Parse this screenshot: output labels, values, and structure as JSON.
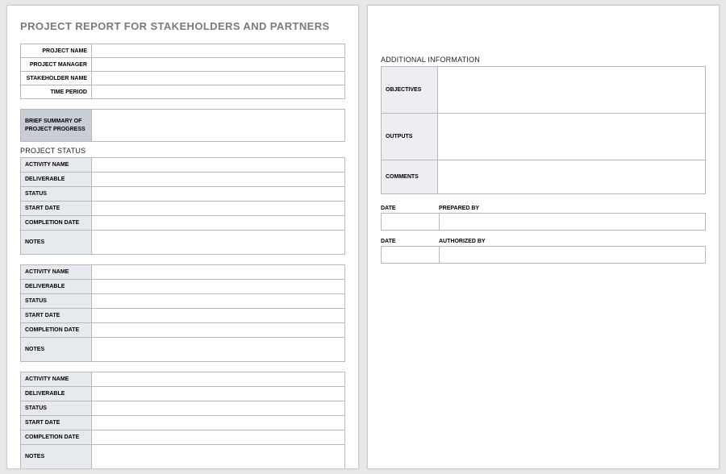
{
  "title": "PROJECT REPORT FOR STAKEHOLDERS AND PARTNERS",
  "projectInfo": {
    "labels": {
      "projectName": "PROJECT NAME",
      "projectManager": "PROJECT MANAGER",
      "stakeholderName": "STAKEHOLDER NAME",
      "timePeriod": "TIME PERIOD"
    },
    "values": {
      "projectName": "",
      "projectManager": "",
      "stakeholderName": "",
      "timePeriod": ""
    }
  },
  "summary": {
    "label": "BRIEF SUMMARY OF PROJECT PROGRESS",
    "value": ""
  },
  "projectStatusHeading": "PROJECT STATUS",
  "statusLabels": {
    "activityName": "ACTIVITY NAME",
    "deliverable": "DELIVERABLE",
    "status": "STATUS",
    "startDate": "START DATE",
    "completionDate": "COMPLETION DATE",
    "notes": "NOTES"
  },
  "statusBlocks": [
    {
      "activityName": "",
      "deliverable": "",
      "status": "",
      "startDate": "",
      "completionDate": "",
      "notes": ""
    },
    {
      "activityName": "",
      "deliverable": "",
      "status": "",
      "startDate": "",
      "completionDate": "",
      "notes": ""
    },
    {
      "activityName": "",
      "deliverable": "",
      "status": "",
      "startDate": "",
      "completionDate": "",
      "notes": ""
    }
  ],
  "page2": {
    "additionalInfoHeading": "ADDITIONAL INFORMATION",
    "fields": {
      "objectives": {
        "label": "OBJECTIVES",
        "value": ""
      },
      "outputs": {
        "label": "OUTPUTS",
        "value": ""
      },
      "comments": {
        "label": "COMMENTS",
        "value": ""
      }
    },
    "sign": {
      "dateLabel": "DATE",
      "preparedByLabel": "PREPARED BY",
      "authorizedByLabel": "AUTHORIZED BY",
      "prepared": {
        "date": "",
        "by": ""
      },
      "authorized": {
        "date": "",
        "by": ""
      }
    }
  }
}
